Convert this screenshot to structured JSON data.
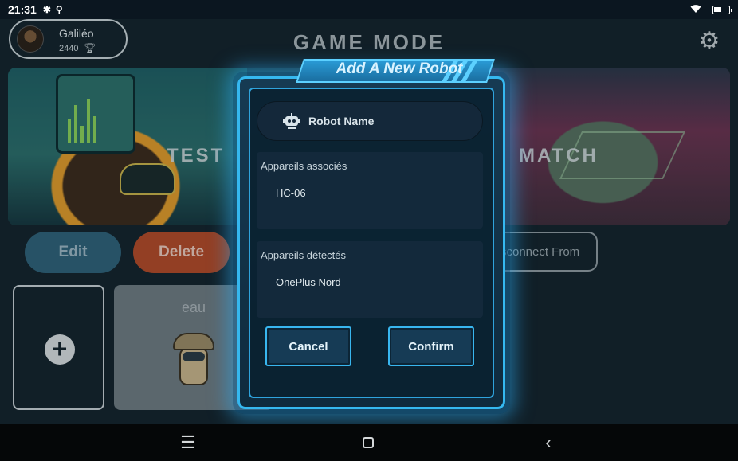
{
  "status_bar": {
    "time": "21:31",
    "icons": [
      "bluetooth-icon",
      "usb-icon",
      "wifi-icon",
      "battery-icon"
    ],
    "battery_level": 0.5
  },
  "profile": {
    "name": "Galiléo",
    "score": "2440"
  },
  "header": {
    "title": "GAME MODE"
  },
  "banner": {
    "left_label": "TEST",
    "right_label": "MATCH"
  },
  "actions": {
    "edit": "Edit",
    "delete": "Delete",
    "disconnect": "Disconnect From"
  },
  "robots": [
    {
      "name": "eau"
    }
  ],
  "dialog": {
    "title": "Add A New Robot",
    "name_placeholder": "Robot Name",
    "paired_heading": "Appareils associés",
    "paired_devices": [
      "HC-06"
    ],
    "detected_heading": "Appareils détectés",
    "detected_devices": [
      "OnePlus Nord"
    ],
    "cancel_label": "Cancel",
    "confirm_label": "Confirm"
  },
  "colors": {
    "accent": "#35b8f0",
    "edit_button": "#2f6178",
    "delete_button": "#b34a28",
    "background": "#14232b"
  }
}
